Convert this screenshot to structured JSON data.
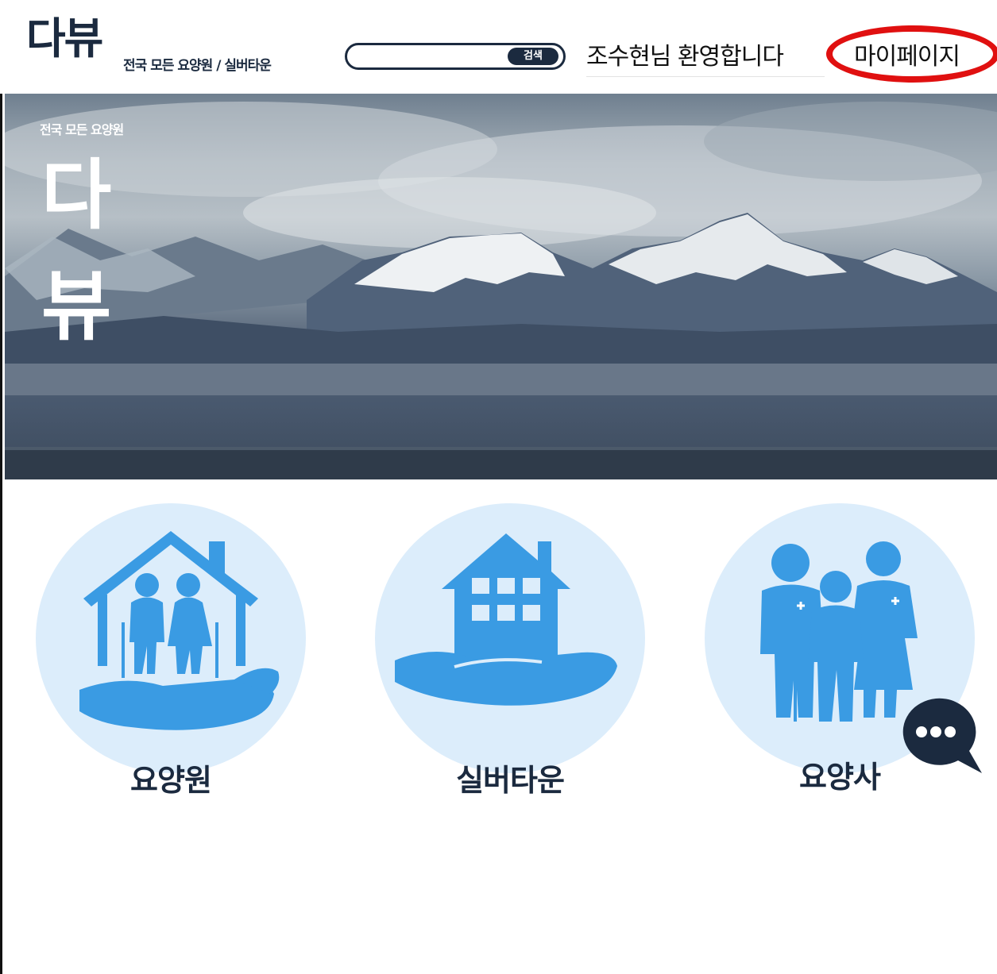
{
  "header": {
    "logo": "다뷰",
    "tagline": "전국 모든 요양원 / 실버타운",
    "search": {
      "placeholder": "",
      "button_label": "검색"
    },
    "welcome": "조수현님 환영합니다",
    "mypage_label": "마이페이지"
  },
  "hero": {
    "small_text": "전국 모든 요양원",
    "big_text_1": "다",
    "big_text_2": "뷰"
  },
  "categories": [
    {
      "label": "요양원"
    },
    {
      "label": "실버타운"
    },
    {
      "label": "요양사"
    }
  ],
  "colors": {
    "brand_dark": "#1b2a3f",
    "icon_blue": "#3a9be3",
    "circle_bg": "#dcedfb",
    "highlight_ring": "#e01010"
  },
  "icons": [
    "elderly-care-home-icon",
    "silver-town-icon",
    "caregiver-icon",
    "chat-bubble-icon"
  ]
}
